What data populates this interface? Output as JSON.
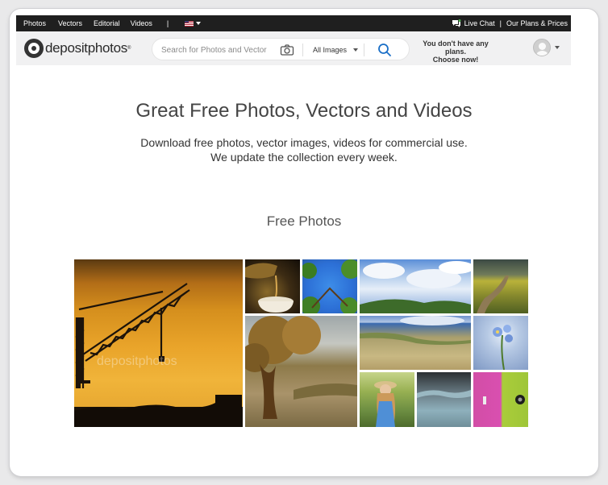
{
  "topbar": {
    "nav": [
      "Photos",
      "Vectors",
      "Editorial",
      "Videos"
    ],
    "divider": "|",
    "live_chat": "Live Chat",
    "right_divider": "|",
    "plans_prices": "Our Plans & Prices",
    "language_icon": "us-flag-icon"
  },
  "header": {
    "logo_text": "depositphotos",
    "logo_reg": "®",
    "search_placeholder": "Search for Photos and Vector",
    "category_select": "All Images",
    "plans_notice_line1": "You don't have any plans.",
    "plans_notice_line2": "Choose now!",
    "icons": [
      "camera-icon",
      "search-icon",
      "avatar-icon",
      "chevron-down-icon",
      "chat-icon"
    ]
  },
  "hero": {
    "title": "Great Free Photos, Vectors and Videos",
    "subtitle_line1": "Download free photos, vector images, videos for commercial use.",
    "subtitle_line2": "We update the collection every week."
  },
  "gallery": {
    "section_title": "Free Photos",
    "watermark": "depositphotos",
    "accent": "#1a6fc7"
  }
}
